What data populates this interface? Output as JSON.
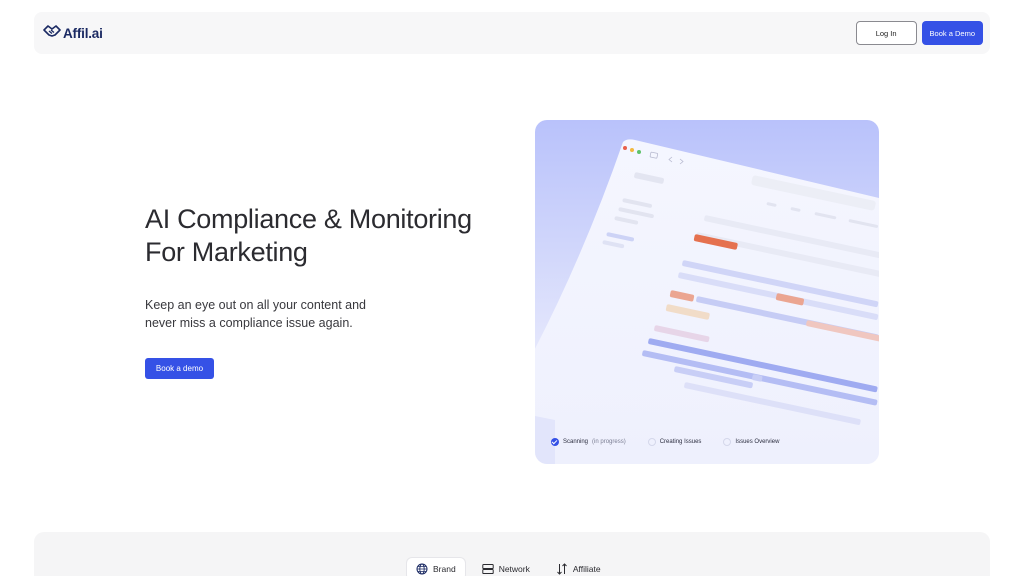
{
  "header": {
    "logo_text": "Affil.ai",
    "login_label": "Log In",
    "book_demo_label": "Book a Demo"
  },
  "hero": {
    "title_line1": "AI Compliance & Monitoring",
    "title_line2": "For Marketing",
    "subtitle_line1": "Keep an eye out on all your content and",
    "subtitle_line2": "never miss a compliance issue again.",
    "cta_label": "Book a demo"
  },
  "preview": {
    "steps": [
      {
        "label": "Scanning",
        "note": "(in progress)",
        "state": "done"
      },
      {
        "label": "Creating Issues",
        "state": "pending"
      },
      {
        "label": "Issues Overview",
        "state": "pending"
      }
    ]
  },
  "tabs": [
    {
      "label": "Brand",
      "icon": "globe-icon",
      "active": true
    },
    {
      "label": "Network",
      "icon": "server-icon",
      "active": false
    },
    {
      "label": "Affiliate",
      "icon": "sort-arrows-icon",
      "active": false
    }
  ],
  "colors": {
    "accent": "#3551e6",
    "brand_text": "#1b2a63",
    "issue_red": "#e5714f"
  }
}
